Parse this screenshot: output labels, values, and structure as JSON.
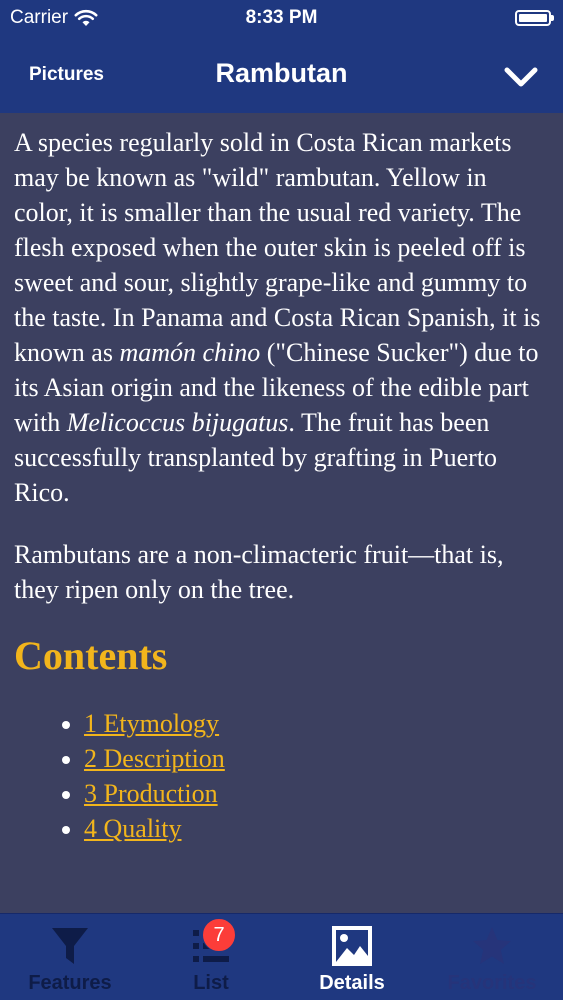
{
  "status_bar": {
    "carrier": "Carrier",
    "time": "8:33 PM",
    "battery_level": 1.0
  },
  "nav": {
    "back_label": "Pictures",
    "title": "Rambutan",
    "right_icon": "chevron-down-icon"
  },
  "article": {
    "p1": {
      "t1": "A species regularly sold in Costa Rican markets may be known as \"wild\" rambutan. Yellow in color, it is smaller than the usual red variety. The flesh exposed when the outer skin is peeled off is sweet and sour, slightly grape-like and gummy to the taste. In Panama and Costa Rican Spanish, it is known as ",
      "i1": "mamón chino",
      "t2": " (\"Chinese Sucker\") due to its Asian origin and the likeness of the edible part with ",
      "i2": "Melicoccus bijugatus",
      "t3": ". The fruit has been successfully transplanted by grafting in Puerto Rico."
    },
    "p2": "Rambutans are a non-climacteric fruit—that is, they ripen only on the tree.",
    "contents_heading": "Contents",
    "contents": [
      "1 Etymology",
      "2 Description",
      "3 Production",
      "4 Quality"
    ]
  },
  "tabbar": {
    "tabs": [
      {
        "label": "Features",
        "icon": "funnel-icon"
      },
      {
        "label": "List",
        "icon": "list-icon",
        "badge": "7"
      },
      {
        "label": "Details",
        "icon": "picture-icon"
      },
      {
        "label": "Favorites",
        "icon": "star-icon"
      }
    ]
  },
  "colors": {
    "nav_background": "#1f3880",
    "content_background": "#3c4060",
    "heading_accent": "#f2b51c",
    "link": "#f2b51c",
    "badge": "#fc3d39"
  }
}
